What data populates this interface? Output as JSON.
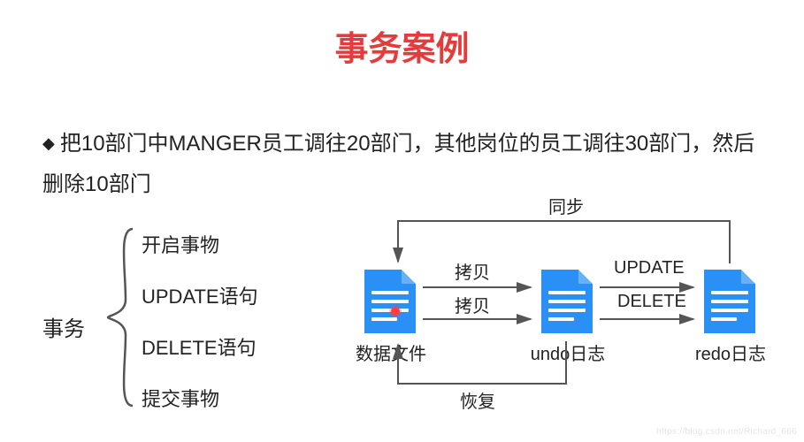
{
  "title": "事务案例",
  "description": "把10部门中MANGER员工调往20部门，其他岗位的员工调往30部门，然后删除10部门",
  "tx_label": "事务",
  "steps": {
    "s1": "开启事物",
    "s2": "UPDATE语句",
    "s3": "DELETE语句",
    "s4": "提交事物"
  },
  "files": {
    "data": "数据文件",
    "undo": "undo日志",
    "redo": "redo日志"
  },
  "arrows": {
    "sync": "同步",
    "copy1": "拷贝",
    "copy2": "拷贝",
    "update": "UPDATE",
    "delete": "DELETE",
    "restore": "恢复"
  },
  "watermark": "https://blog.csdn.net/Richard_666",
  "colors": {
    "title": "#e43c3c",
    "file": "#2a90f5",
    "arrow": "#555555"
  }
}
